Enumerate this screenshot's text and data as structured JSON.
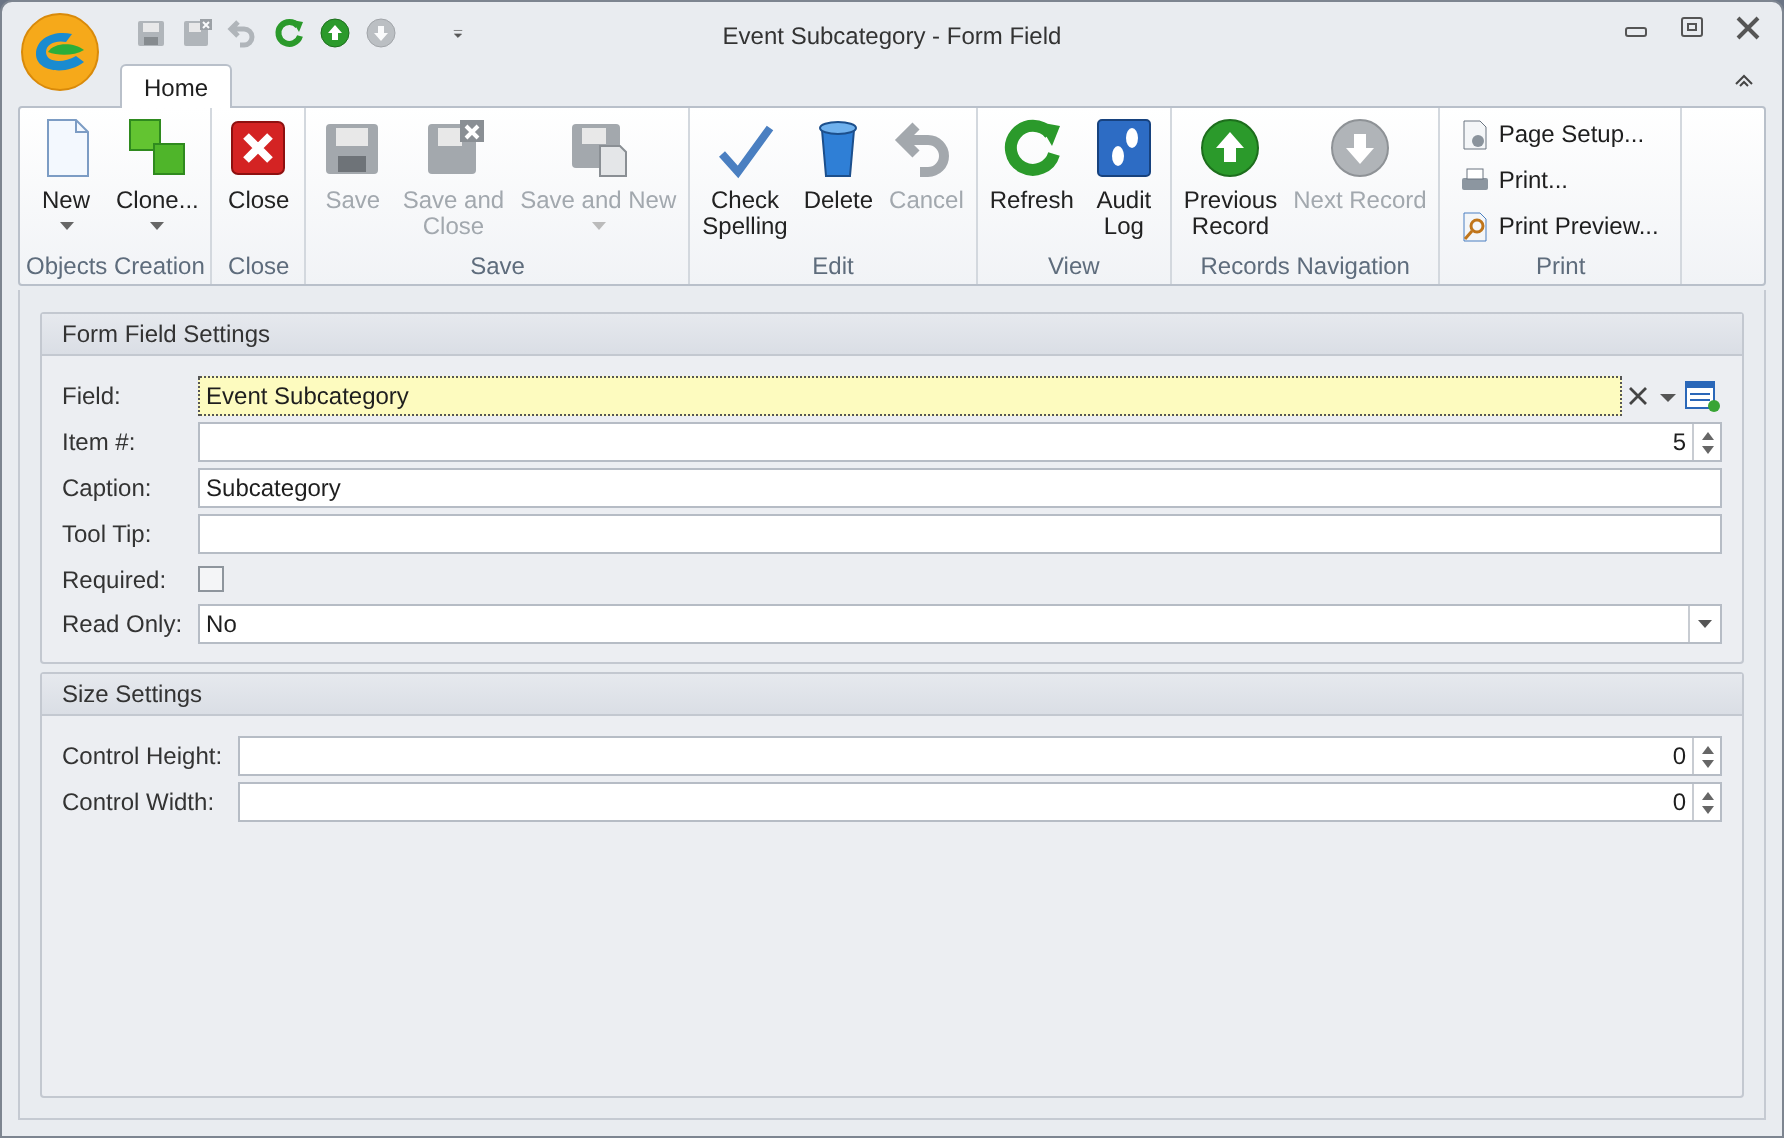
{
  "window": {
    "title": "Event Subcategory - Form Field"
  },
  "quick_access": [
    {
      "kind": "save",
      "disabled": true
    },
    {
      "kind": "save-close",
      "disabled": true
    },
    {
      "kind": "undo",
      "disabled": true
    },
    {
      "kind": "refresh",
      "disabled": false
    },
    {
      "kind": "up",
      "disabled": false
    },
    {
      "kind": "down",
      "disabled": true
    },
    {
      "kind": "customize",
      "disabled": false
    }
  ],
  "tabs": [
    {
      "label": "Home",
      "selected": true
    }
  ],
  "ribbon_groups": [
    {
      "label": "Objects Creation",
      "buttons": [
        {
          "kind": "new",
          "lines": [
            "New"
          ],
          "dropdown": true,
          "disabled": false
        },
        {
          "kind": "clone",
          "lines": [
            "Clone..."
          ],
          "dropdown": true,
          "disabled": false
        }
      ]
    },
    {
      "label": "Close",
      "buttons": [
        {
          "kind": "close",
          "lines": [
            "Close"
          ],
          "dropdown": false,
          "disabled": false
        }
      ]
    },
    {
      "label": "Save",
      "buttons": [
        {
          "kind": "save",
          "lines": [
            "Save"
          ],
          "dropdown": false,
          "disabled": true
        },
        {
          "kind": "save-close",
          "lines": [
            "Save and",
            "Close"
          ],
          "dropdown": false,
          "disabled": true
        },
        {
          "kind": "save-new",
          "lines": [
            "Save and New"
          ],
          "dropdown": true,
          "disabled": true
        }
      ]
    },
    {
      "label": "Edit",
      "buttons": [
        {
          "kind": "spelling",
          "lines": [
            "Check",
            "Spelling"
          ],
          "dropdown": false,
          "disabled": false
        },
        {
          "kind": "delete",
          "lines": [
            "Delete"
          ],
          "dropdown": false,
          "disabled": false
        },
        {
          "kind": "undo",
          "lines": [
            "Cancel"
          ],
          "dropdown": false,
          "disabled": true
        }
      ]
    },
    {
      "label": "View",
      "buttons": [
        {
          "kind": "refresh",
          "lines": [
            "Refresh"
          ],
          "dropdown": false,
          "disabled": false
        },
        {
          "kind": "audit",
          "lines": [
            "Audit",
            "Log"
          ],
          "dropdown": false,
          "disabled": false
        }
      ]
    },
    {
      "label": "Records Navigation",
      "buttons": [
        {
          "kind": "up",
          "lines": [
            "Previous",
            "Record"
          ],
          "dropdown": false,
          "disabled": false
        },
        {
          "kind": "down",
          "lines": [
            "Next Record"
          ],
          "dropdown": false,
          "disabled": true
        }
      ]
    },
    {
      "label": "Print",
      "small_buttons": [
        {
          "kind": "page-setup",
          "label": "Page Setup..."
        },
        {
          "kind": "print",
          "label": "Print..."
        },
        {
          "kind": "preview",
          "label": "Print Preview..."
        }
      ]
    }
  ],
  "sections": [
    {
      "title": "Form Field Settings",
      "fields": [
        {
          "kind": "lookup",
          "label": "Field:",
          "value": "Event Subcategory",
          "focused": true
        },
        {
          "kind": "spin",
          "label": "Item #:",
          "value": "5"
        },
        {
          "kind": "text",
          "label": "Caption:",
          "value": "Subcategory"
        },
        {
          "kind": "text",
          "label": "Tool Tip:"
        },
        {
          "kind": "checkbox",
          "label": "Required:",
          "checked": false
        },
        {
          "kind": "combo",
          "label": "Read Only:",
          "value": "No"
        }
      ]
    },
    {
      "title": "Size Settings",
      "fields": [
        {
          "kind": "spin",
          "label": "Control Height:",
          "value": "0"
        },
        {
          "kind": "spin",
          "label": "Control Width:",
          "value": "0"
        }
      ]
    }
  ]
}
